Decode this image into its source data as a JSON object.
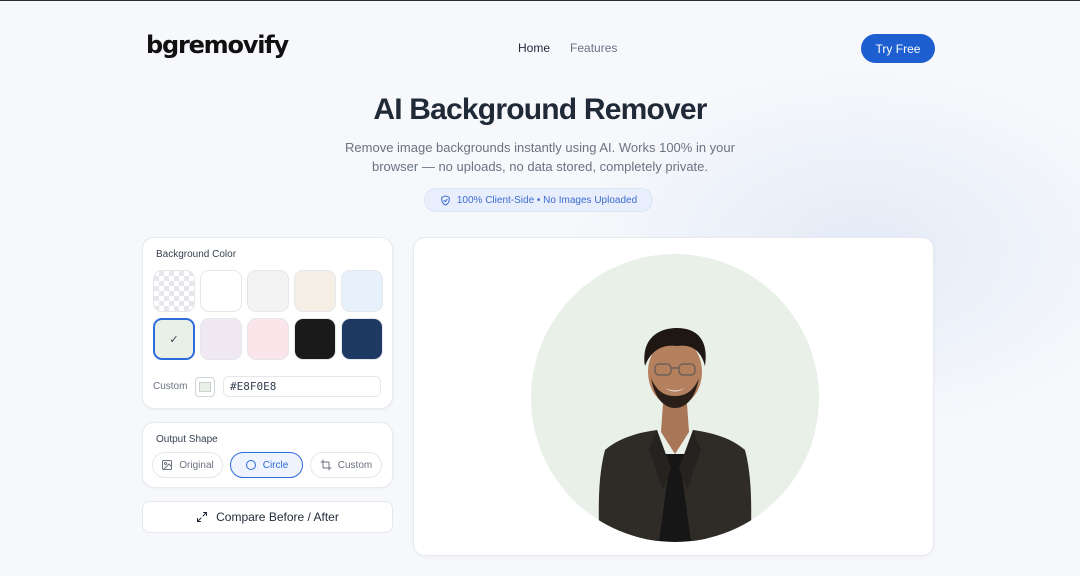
{
  "header": {
    "logo": "bgremovify",
    "nav": [
      {
        "label": "Home"
      },
      {
        "label": "Features"
      }
    ],
    "cta_label": "Try Free"
  },
  "hero": {
    "title": "AI Background Remover",
    "subtitle": "Remove image backgrounds instantly using AI. Works 100% in your browser — no uploads, no data stored, completely private.",
    "badge": "100% Client-Side • No Images Uploaded",
    "badge_icon": "shield-icon"
  },
  "background_color": {
    "title": "Background Color",
    "swatches": [
      {
        "name": "transparent",
        "color": "transparent"
      },
      {
        "name": "white",
        "color": "#FFFFFF"
      },
      {
        "name": "light-gray",
        "color": "#F3F3F3"
      },
      {
        "name": "cream",
        "color": "#F6EFE6"
      },
      {
        "name": "light-blue",
        "color": "#E6F1FB"
      },
      {
        "name": "sage",
        "color": "#E8F0E8",
        "selected": true
      },
      {
        "name": "lavender",
        "color": "#F0E9F4"
      },
      {
        "name": "pink",
        "color": "#FBE4EA"
      },
      {
        "name": "black",
        "color": "#1A1A1A"
      },
      {
        "name": "navy",
        "color": "#1E3A63"
      }
    ],
    "selected_mark": "✓",
    "custom_label": "Custom",
    "custom_value": "#E8F0E8"
  },
  "output_shape": {
    "title": "Output Shape",
    "options": [
      {
        "label": "Original",
        "icon": "image-icon",
        "active": false
      },
      {
        "label": "Circle",
        "icon": "circle-icon",
        "active": true
      },
      {
        "label": "Custom",
        "icon": "crop-icon",
        "active": false
      }
    ]
  },
  "compare_label": "Compare Before / After",
  "compare_icon": "expand-arrows-icon",
  "preview": {
    "background": "#E8F0E8",
    "shape": "circle"
  },
  "colors": {
    "accent": "#1D5FD1",
    "page_bg": "#F6F8FB"
  }
}
